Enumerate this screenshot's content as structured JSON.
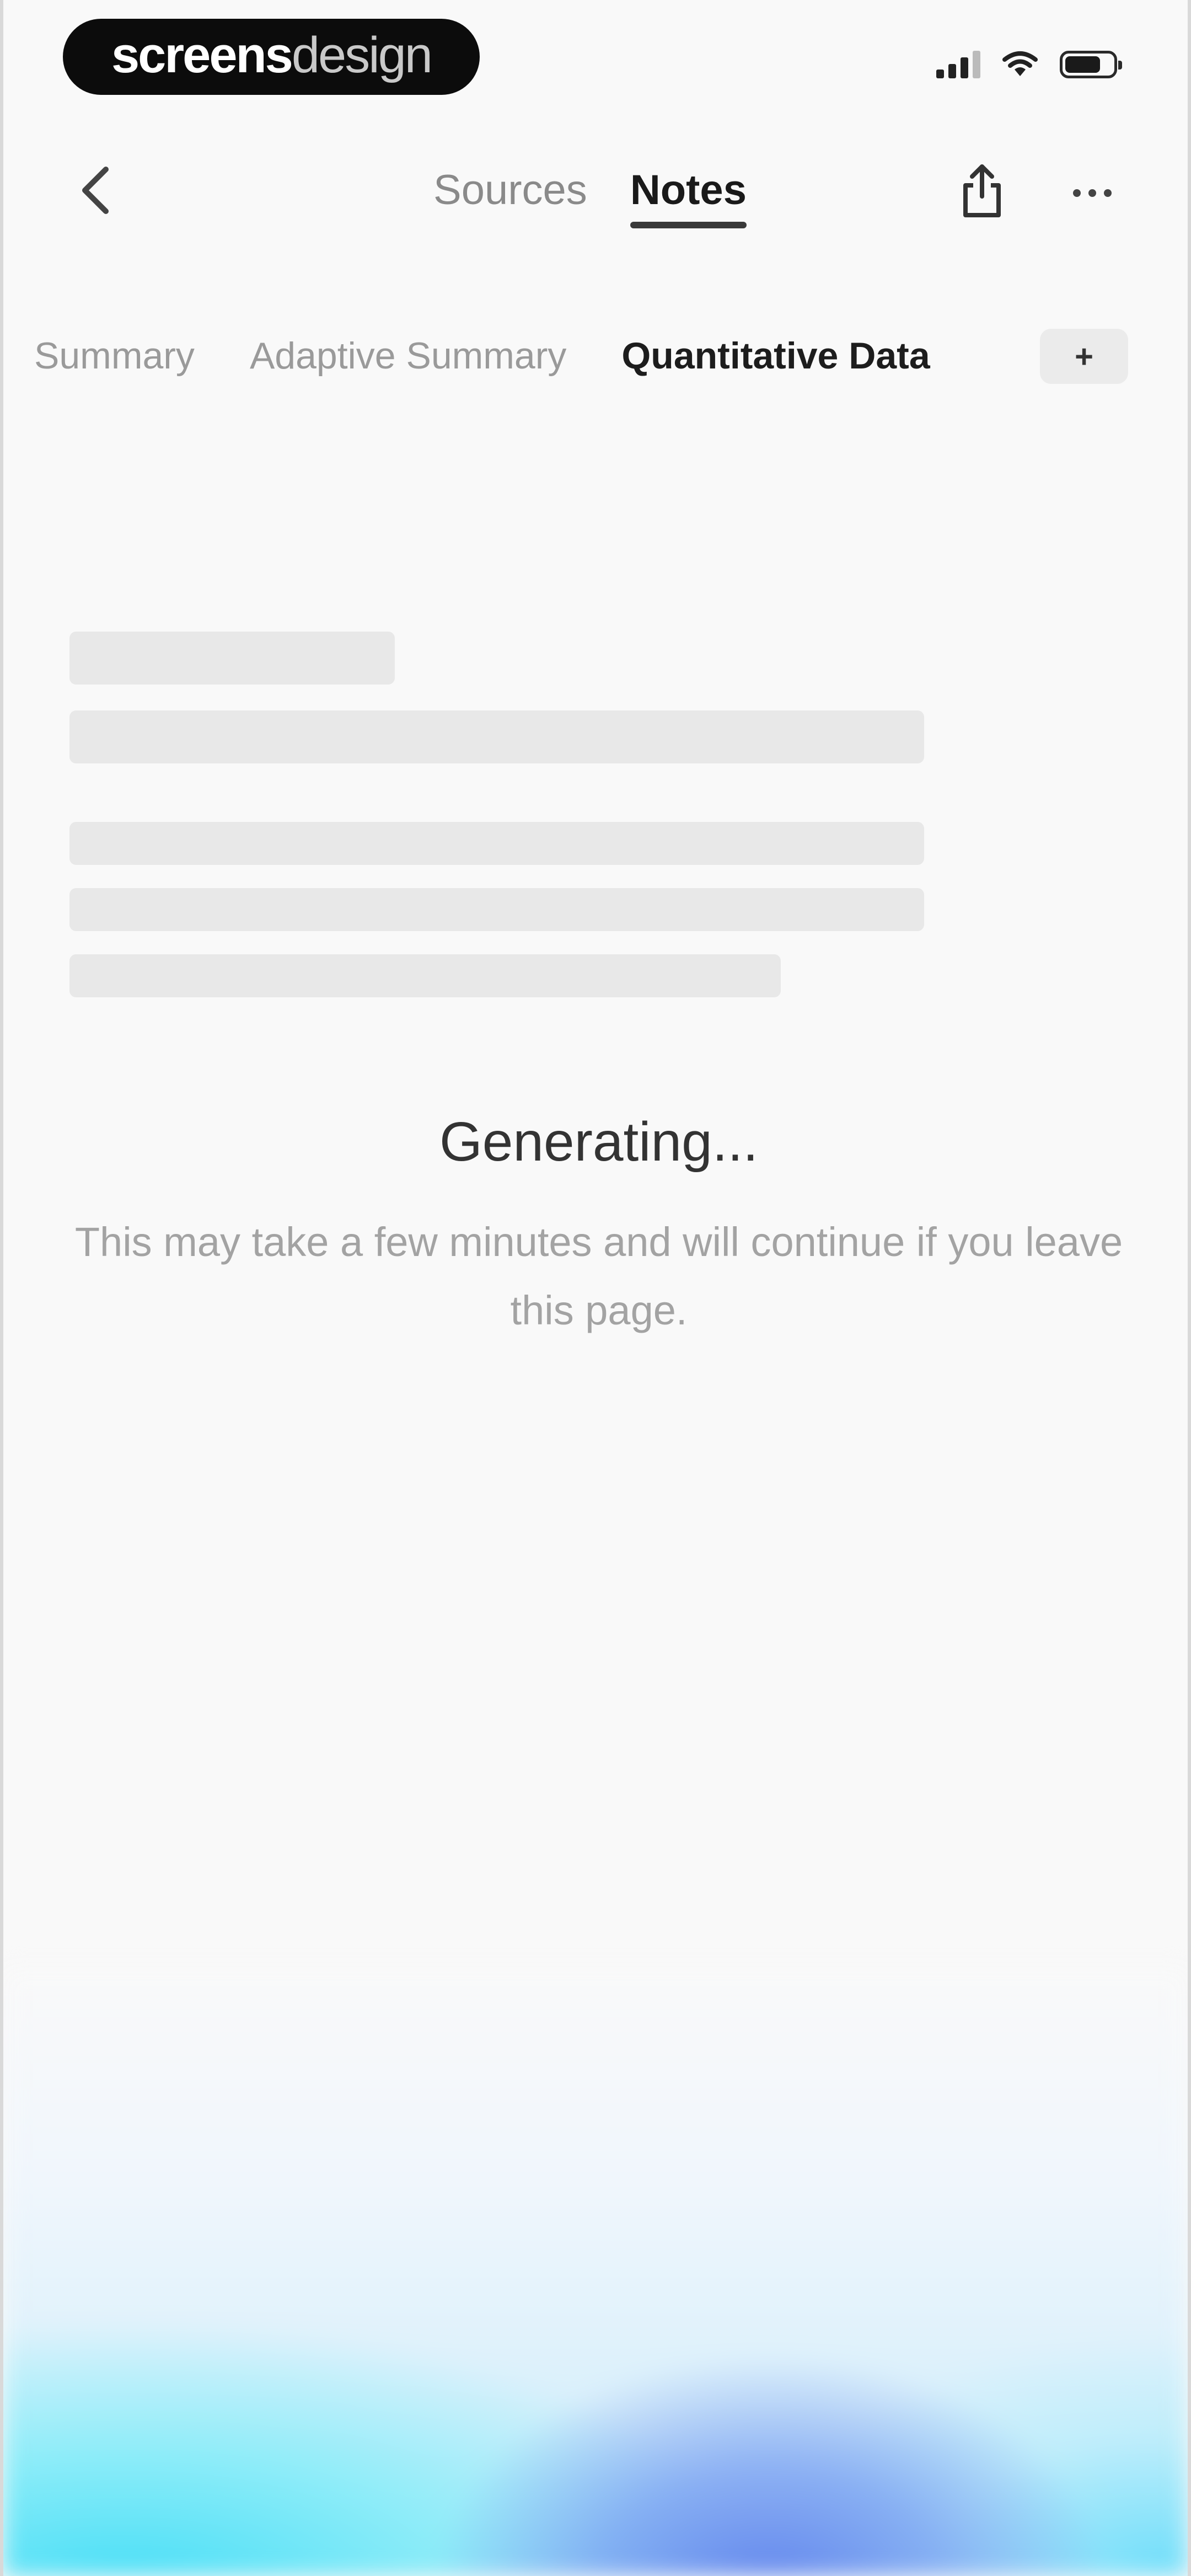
{
  "status_bar": {
    "brand_bold": "screens",
    "brand_light": "design",
    "signal_icon": "cellular-signal-icon",
    "wifi_icon": "wifi-icon",
    "battery_icon": "battery-icon",
    "battery_level": 0.75
  },
  "nav": {
    "back_icon": "chevron-left-icon",
    "tabs": [
      {
        "label": "Sources",
        "active": false
      },
      {
        "label": "Notes",
        "active": true
      }
    ],
    "share_icon": "share-icon",
    "more_icon": "more-horizontal-icon"
  },
  "note_tabs": {
    "items": [
      {
        "label": "Summary",
        "active": false
      },
      {
        "label": "Adaptive Summary",
        "active": false
      },
      {
        "label": "Quantitative Data",
        "active": true
      }
    ],
    "add_label": "+"
  },
  "generating": {
    "title": "Generating...",
    "message": "This may take a few minutes and will continue if you leave this page."
  },
  "colors": {
    "background": "#f9f9f9",
    "accent_cyan": "#46def6",
    "accent_blue": "#5c80ec"
  }
}
